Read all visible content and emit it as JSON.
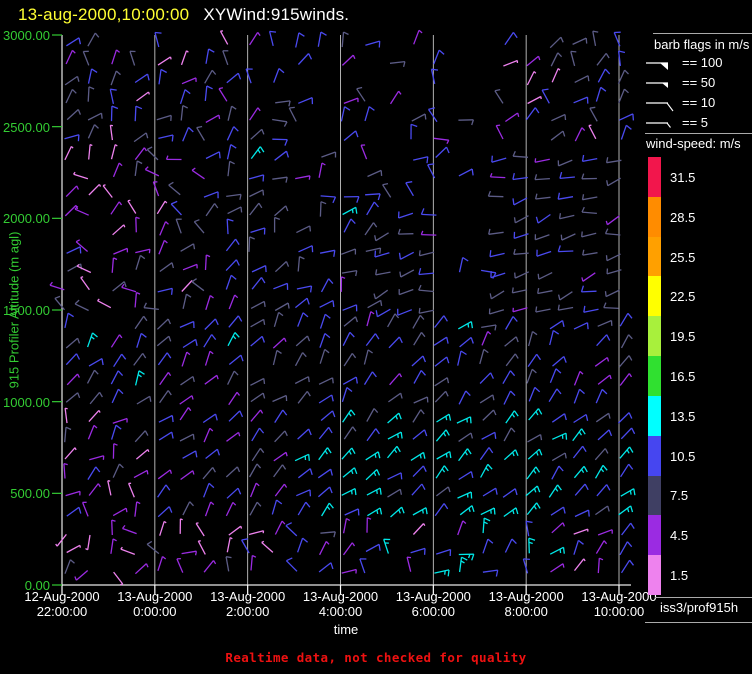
{
  "window": {
    "title_datetime": "13-aug-2000,10:00:00",
    "title_app": "XYWind:915winds."
  },
  "colors": {
    "background": "#000000",
    "title_datetime": "#ffff33",
    "title_app": "#ffffff",
    "axis_line": "#e8e8e8",
    "gridline": "#c4c4c4",
    "y_axis_text": "#33cc33",
    "x_axis_text": "#ffffff",
    "footer_text": "#ee1111"
  },
  "chart_data": {
    "type": "wind-barb-time-height-profile",
    "title": "XYWind:915winds.",
    "xlabel": "time",
    "ylabel": "915 Profiler Altitude (m agl)",
    "x_ticks": [
      {
        "date": "12-Aug-2000",
        "time": "22:00:00"
      },
      {
        "date": "13-Aug-2000",
        "time": "0:00:00"
      },
      {
        "date": "13-Aug-2000",
        "time": "2:00:00"
      },
      {
        "date": "13-Aug-2000",
        "time": "4:00:00"
      },
      {
        "date": "13-Aug-2000",
        "time": "6:00:00"
      },
      {
        "date": "13-Aug-2000",
        "time": "8:00:00"
      },
      {
        "date": "13-Aug-2000",
        "time": "10:00:00"
      }
    ],
    "y_ticks": [
      "3000.00",
      "2500.00",
      "2000.00",
      "1500.00",
      "1000.00",
      "500.00",
      "0.00"
    ],
    "y_range_m": [
      0,
      3000
    ],
    "x_range_hours": 12,
    "grid": "vertical-only",
    "barb_legend": {
      "title": "barb flags in m/s",
      "rows": [
        {
          "symbol": "pennant-large",
          "label": "== 100"
        },
        {
          "symbol": "pennant-small",
          "label": "== 50"
        },
        {
          "symbol": "full-barb",
          "label": "== 10"
        },
        {
          "symbol": "half-barb",
          "label": "== 5"
        }
      ]
    },
    "speed_scale": {
      "title": "wind-speed: m/s",
      "entries": [
        {
          "value": "31.5",
          "color": "#f2164c"
        },
        {
          "value": "28.5",
          "color": "#ff8c00"
        },
        {
          "value": "25.5",
          "color": "#ffa000"
        },
        {
          "value": "22.5",
          "color": "#ffff00"
        },
        {
          "value": "19.5",
          "color": "#a8f03c"
        },
        {
          "value": "16.5",
          "color": "#30e030"
        },
        {
          "value": "13.5",
          "color": "#00ffff"
        },
        {
          "value": "10.5",
          "color": "#4646f0"
        },
        {
          "value": "7.5",
          "color": "#3f3f63"
        },
        {
          "value": "4.5",
          "color": "#9b2be2"
        },
        {
          "value": "1.5",
          "color": "#ee82ee"
        }
      ]
    },
    "station_label": "iss3/prof915h",
    "footer_notice": "Realtime data, not checked for quality",
    "barb_field": {
      "seed": 42,
      "cols": 25,
      "rows": 29,
      "speed_classes": {
        "pink": {
          "speed": 1.5,
          "color": "#ee82ee"
        },
        "purple": {
          "speed": 4.5,
          "color": "#9b2be2"
        },
        "slate": {
          "speed": 7.5,
          "color": "#5c5c86"
        },
        "blue": {
          "speed": 10.5,
          "color": "#4a4af0"
        },
        "cyan": {
          "speed": 13.5,
          "color": "#00e8e8"
        }
      },
      "zones": [
        {
          "t": [
            8.1,
            9.4
          ],
          "a": [
            1400,
            3050
          ],
          "drop": 0.85,
          "dir": 40,
          "jit": 50,
          "mix": [
            [
              "slate",
              0.6
            ],
            [
              "blue",
              0.4
            ]
          ]
        },
        {
          "t": [
            4.3,
            8.1
          ],
          "a": [
            2050,
            3050
          ],
          "drop": 0.38,
          "dir": 55,
          "jit": 70,
          "mix": [
            [
              "slate",
              0.45
            ],
            [
              "blue",
              0.3
            ],
            [
              "purple",
              0.25
            ]
          ]
        },
        {
          "t": [
            0,
            12.5
          ],
          "a": [
            2400,
            3050
          ],
          "drop": 0.12,
          "dir": 68,
          "jit": 55,
          "mix": [
            [
              "slate",
              0.45
            ],
            [
              "blue",
              0.3
            ],
            [
              "purple",
              0.15
            ],
            [
              "pink",
              0.1
            ]
          ]
        },
        {
          "t": [
            0,
            3.5
          ],
          "a": [
            1450,
            2400
          ],
          "drop": 0.08,
          "dir": 95,
          "jit": 85,
          "mix": [
            [
              "slate",
              0.4
            ],
            [
              "purple",
              0.3
            ],
            [
              "pink",
              0.2
            ],
            [
              "blue",
              0.1
            ]
          ]
        },
        {
          "t": [
            3.5,
            7.0
          ],
          "a": [
            1450,
            2400
          ],
          "drop": 0.15,
          "dir": 50,
          "jit": 45,
          "mix": [
            [
              "slate",
              0.6
            ],
            [
              "blue",
              0.25
            ],
            [
              "purple",
              0.1
            ],
            [
              "cyan",
              0.05
            ]
          ]
        },
        {
          "t": [
            7.0,
            12.5
          ],
          "a": [
            1450,
            2400
          ],
          "drop": 0.12,
          "dir": 195,
          "jit": 22,
          "mix": [
            [
              "slate",
              0.6
            ],
            [
              "blue",
              0.3
            ],
            [
              "purple",
              0.1
            ]
          ]
        },
        {
          "t": [
            0,
            12.5
          ],
          "a": [
            900,
            1450
          ],
          "drop": 0.05,
          "dir": 50,
          "jit": 28,
          "mix": [
            [
              "blue",
              0.45
            ],
            [
              "slate",
              0.4
            ],
            [
              "purple",
              0.1
            ],
            [
              "cyan",
              0.05
            ]
          ]
        },
        {
          "t": [
            0,
            2.0
          ],
          "a": [
            350,
            900
          ],
          "drop": 0.05,
          "dir": 65,
          "jit": 50,
          "mix": [
            [
              "purple",
              0.4
            ],
            [
              "pink",
              0.3
            ],
            [
              "slate",
              0.15
            ],
            [
              "blue",
              0.15
            ]
          ]
        },
        {
          "t": [
            2.0,
            5.0
          ],
          "a": [
            350,
            900
          ],
          "drop": 0.05,
          "dir": 50,
          "jit": 24,
          "mix": [
            [
              "blue",
              0.5
            ],
            [
              "purple",
              0.25
            ],
            [
              "slate",
              0.25
            ]
          ]
        },
        {
          "t": [
            5.0,
            12.5
          ],
          "a": [
            350,
            900
          ],
          "drop": 0.04,
          "dir": 42,
          "jit": 20,
          "mix": [
            [
              "cyan",
              0.55
            ],
            [
              "blue",
              0.35
            ],
            [
              "slate",
              0.1
            ]
          ]
        },
        {
          "t": [
            0,
            2.5
          ],
          "a": [
            0,
            350
          ],
          "drop": 0.1,
          "dir": 170,
          "jit": 150,
          "mix": [
            [
              "pink",
              0.55
            ],
            [
              "purple",
              0.35
            ],
            [
              "slate",
              0.1
            ]
          ]
        },
        {
          "t": [
            2.5,
            6.0
          ],
          "a": [
            0,
            350
          ],
          "drop": 0.08,
          "dir": 70,
          "jit": 70,
          "mix": [
            [
              "pink",
              0.3
            ],
            [
              "purple",
              0.4
            ],
            [
              "blue",
              0.2
            ],
            [
              "slate",
              0.1
            ]
          ]
        },
        {
          "t": [
            6.0,
            12.5
          ],
          "a": [
            0,
            350
          ],
          "drop": 0.06,
          "dir": 55,
          "jit": 55,
          "mix": [
            [
              "purple",
              0.4
            ],
            [
              "blue",
              0.3
            ],
            [
              "cyan",
              0.2
            ],
            [
              "pink",
              0.1
            ]
          ]
        }
      ]
    }
  }
}
